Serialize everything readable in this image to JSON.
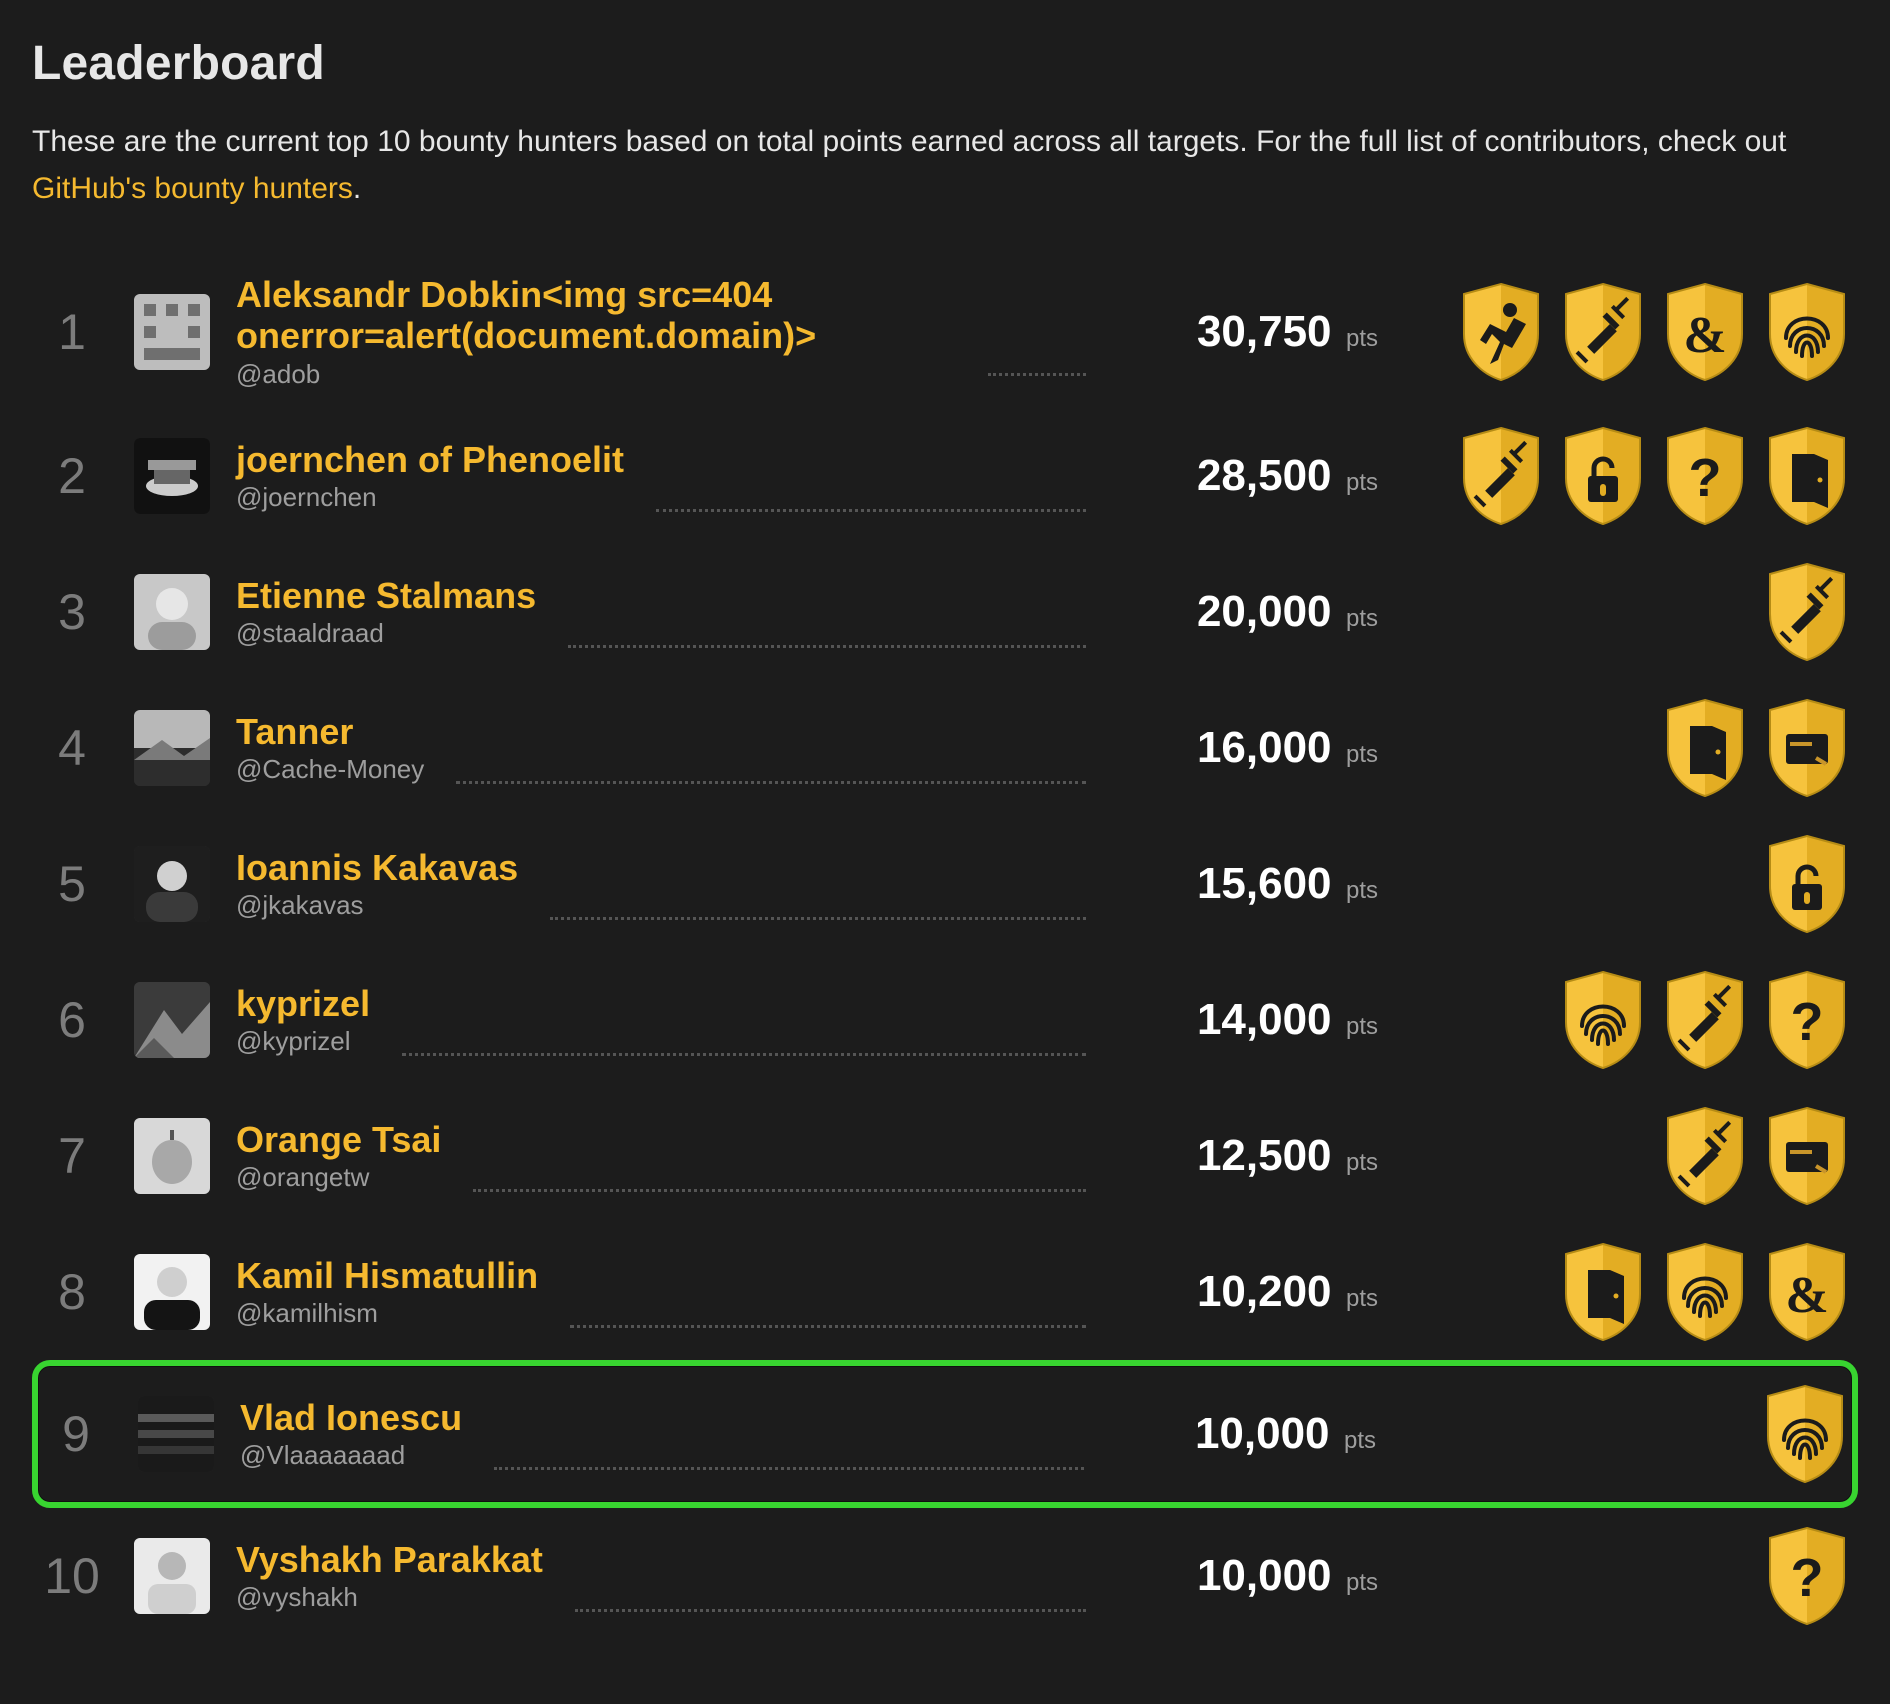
{
  "title": "Leaderboard",
  "intro_pre": "These are the current top 10 bounty hunters based on total points earned across all targets. For the full list of contributors, check out ",
  "intro_link": "GitHub's bounty hunters",
  "intro_post": ".",
  "pts_label": "pts",
  "colors": {
    "accent": "#f5b92f",
    "highlight_border": "#38d430"
  },
  "badge_icons": {
    "runner": "running-person-icon",
    "syringe": "syringe-icon",
    "ampersand": "ampersand-icon",
    "fingerprint": "fingerprint-icon",
    "lock": "open-lock-icon",
    "question": "question-icon",
    "door": "open-door-icon",
    "card": "card-icon"
  },
  "rows": [
    {
      "rank": "1",
      "name": "Aleksandr Dobkin<img src=404 onerror=alert(document.domain)>",
      "handle": "@adob",
      "points": "30,750",
      "avatar": "blocks",
      "badges": [
        "runner",
        "syringe",
        "ampersand",
        "fingerprint"
      ],
      "highlight": false
    },
    {
      "rank": "2",
      "name": "joernchen of Phenoelit",
      "handle": "@joernchen",
      "points": "28,500",
      "avatar": "drums",
      "badges": [
        "syringe",
        "lock",
        "question",
        "door"
      ],
      "highlight": false
    },
    {
      "rank": "3",
      "name": "Etienne Stalmans",
      "handle": "@staaldraad",
      "points": "20,000",
      "avatar": "face1",
      "badges": [
        "syringe"
      ],
      "highlight": false
    },
    {
      "rank": "4",
      "name": "Tanner",
      "handle": "@Cache-Money",
      "points": "16,000",
      "avatar": "landscape",
      "badges": [
        "door",
        "card"
      ],
      "highlight": false
    },
    {
      "rank": "5",
      "name": "Ioannis Kakavas",
      "handle": "@jkakavas",
      "points": "15,600",
      "avatar": "face2",
      "badges": [
        "lock"
      ],
      "highlight": false
    },
    {
      "rank": "6",
      "name": "kyprizel",
      "handle": "@kyprizel",
      "points": "14,000",
      "avatar": "mountain",
      "badges": [
        "fingerprint",
        "syringe",
        "question"
      ],
      "highlight": false
    },
    {
      "rank": "7",
      "name": "Orange Tsai",
      "handle": "@orangetw",
      "points": "12,500",
      "avatar": "apple",
      "badges": [
        "syringe",
        "card"
      ],
      "highlight": false
    },
    {
      "rank": "8",
      "name": "Kamil Hismatullin",
      "handle": "@kamilhism",
      "points": "10,200",
      "avatar": "face3",
      "badges": [
        "door",
        "fingerprint",
        "ampersand"
      ],
      "highlight": false
    },
    {
      "rank": "9",
      "name": "Vlad Ionescu",
      "handle": "@Vlaaaaaaad",
      "points": "10,000",
      "avatar": "bars",
      "badges": [
        "fingerprint"
      ],
      "highlight": true
    },
    {
      "rank": "10",
      "name": "Vyshakh Parakkat",
      "handle": "@vyshakh",
      "points": "10,000",
      "avatar": "face4",
      "badges": [
        "question"
      ],
      "highlight": false
    }
  ]
}
